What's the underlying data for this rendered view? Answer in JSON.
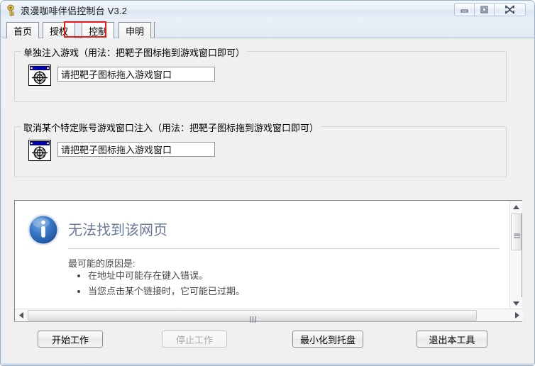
{
  "window": {
    "title": "浪漫咖啡伴侣控制台 V3.2",
    "app_icon": "key-icon",
    "controls": {
      "minimize": "minimize-icon",
      "maximize": "maximize-icon",
      "close": "close-icon"
    }
  },
  "tabs": [
    {
      "label": "首页",
      "active": false
    },
    {
      "label": "授权",
      "active": false
    },
    {
      "label": "控制",
      "active": true
    },
    {
      "label": "申明",
      "active": false
    }
  ],
  "annotation": {
    "color": "#e81a1a",
    "target_tab": "控制"
  },
  "groups": [
    {
      "title": "单独注入游戏（用法：把靶子图标拖到游戏窗口即可）",
      "icon": "target-window-icon",
      "input_value": "请把靶子图标拖入游戏窗口"
    },
    {
      "title": "取消某个特定账号游戏窗口注入（用法：把靶子图标拖到游戏窗口即可）",
      "icon": "target-window-icon",
      "input_value": "请把靶子图标拖入游戏窗口"
    }
  ],
  "browser": {
    "icon": "info-icon",
    "heading": "无法找到该网页",
    "lead": "最可能的原因是:",
    "reasons": [
      "在地址中可能存在键入错误。",
      "当您点击某个链接时，它可能已过期。"
    ],
    "scrollbars": {
      "vertical": {
        "up": "scroll-up-arrow",
        "down": "scroll-down-arrow"
      },
      "horizontal": {
        "left": "scroll-left-arrow",
        "right": "scroll-right-arrow"
      }
    },
    "heading_color": "#6a7a99"
  },
  "footer": {
    "buttons": [
      {
        "label": "开始工作",
        "disabled": false
      },
      {
        "label": "停止工作",
        "disabled": true
      },
      {
        "label": "最小化到托盘",
        "disabled": false
      },
      {
        "label": "退出本工具",
        "disabled": false
      }
    ]
  }
}
